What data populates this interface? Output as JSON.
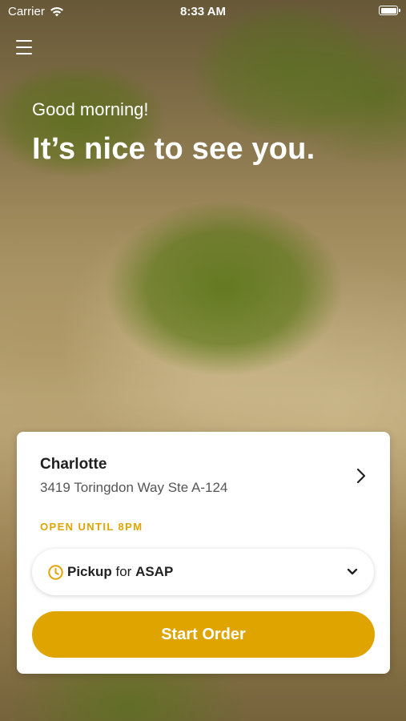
{
  "status_bar": {
    "carrier": "Carrier",
    "time": "8:33 AM",
    "icons": [
      "wifi-icon",
      "battery-icon"
    ]
  },
  "header": {
    "menu_icon": "hamburger-menu-icon"
  },
  "hero": {
    "greeting": "Good morning!",
    "headline": "It’s nice to see you."
  },
  "location_card": {
    "name": "Charlotte",
    "address": "3419 Toringdon Way Ste A-124",
    "open_status": "OPEN UNTIL 8PM",
    "pickup": {
      "method": "Pickup",
      "connector": "for",
      "time": "ASAP"
    },
    "start_button_label": "Start Order"
  },
  "colors": {
    "accent": "#e0a400",
    "card_background": "#ffffff",
    "text_dark": "#1f1f1f",
    "text_secondary": "#555555"
  }
}
